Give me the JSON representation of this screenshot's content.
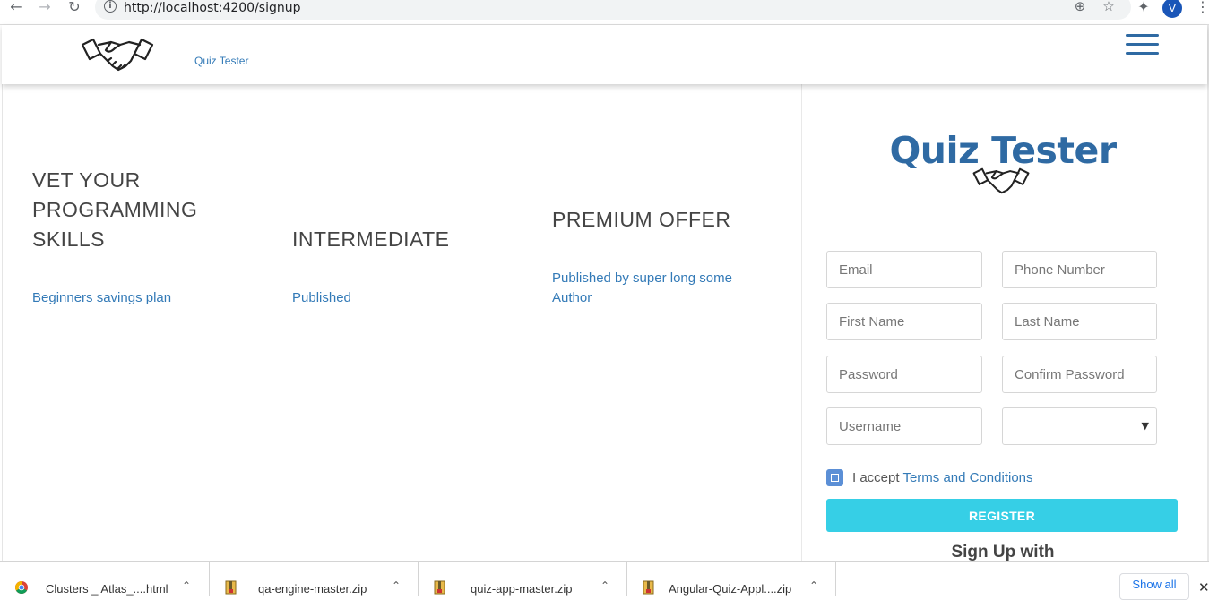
{
  "browser": {
    "url": "http://localhost:4200/signup",
    "profile_initial": "V",
    "icons": [
      "back-arrow-icon",
      "forward-arrow-icon",
      "reload-icon",
      "info-icon",
      "zoom-icon",
      "star-icon",
      "extensions-icon",
      "menu-dots-icon"
    ]
  },
  "header": {
    "brand": "Quiz Tester",
    "logo_icon": "handshake-icon",
    "menu_icon": "hamburger-icon"
  },
  "plans": [
    {
      "title": "VET YOUR PROGRAMMING SKILLS",
      "subtitle": "Beginners savings plan"
    },
    {
      "title": "INTERMEDIATE",
      "subtitle": "Published"
    },
    {
      "title": "PREMIUM OFFER",
      "subtitle": "Published by super long some Author"
    }
  ],
  "form": {
    "title": "Quiz Tester",
    "fields": {
      "email": "Email",
      "phone": "Phone Number",
      "first_name": "First Name",
      "last_name": "Last Name",
      "password": "Password",
      "confirm_password": "Confirm Password",
      "username": "Username"
    },
    "accept_prefix": "I accept",
    "terms_link": "Terms and Conditions",
    "register_label": "REGISTER",
    "signup_with": "Sign Up with"
  },
  "downloads": {
    "items": [
      {
        "name": "Clusters _ Atlas_....html",
        "icon": "chrome-icon"
      },
      {
        "name": "qa-engine-master.zip",
        "icon": "zip-archive-icon"
      },
      {
        "name": "quiz-app-master.zip",
        "icon": "zip-archive-icon"
      },
      {
        "name": "Angular-Quiz-Appl....zip",
        "icon": "zip-archive-icon"
      }
    ],
    "show_all": "Show all"
  },
  "colors": {
    "brand_blue": "#337ab7",
    "title_blue": "#2f6aa3",
    "register_cyan": "#36cfe6",
    "checkbox_blue": "#5b8fd6"
  }
}
